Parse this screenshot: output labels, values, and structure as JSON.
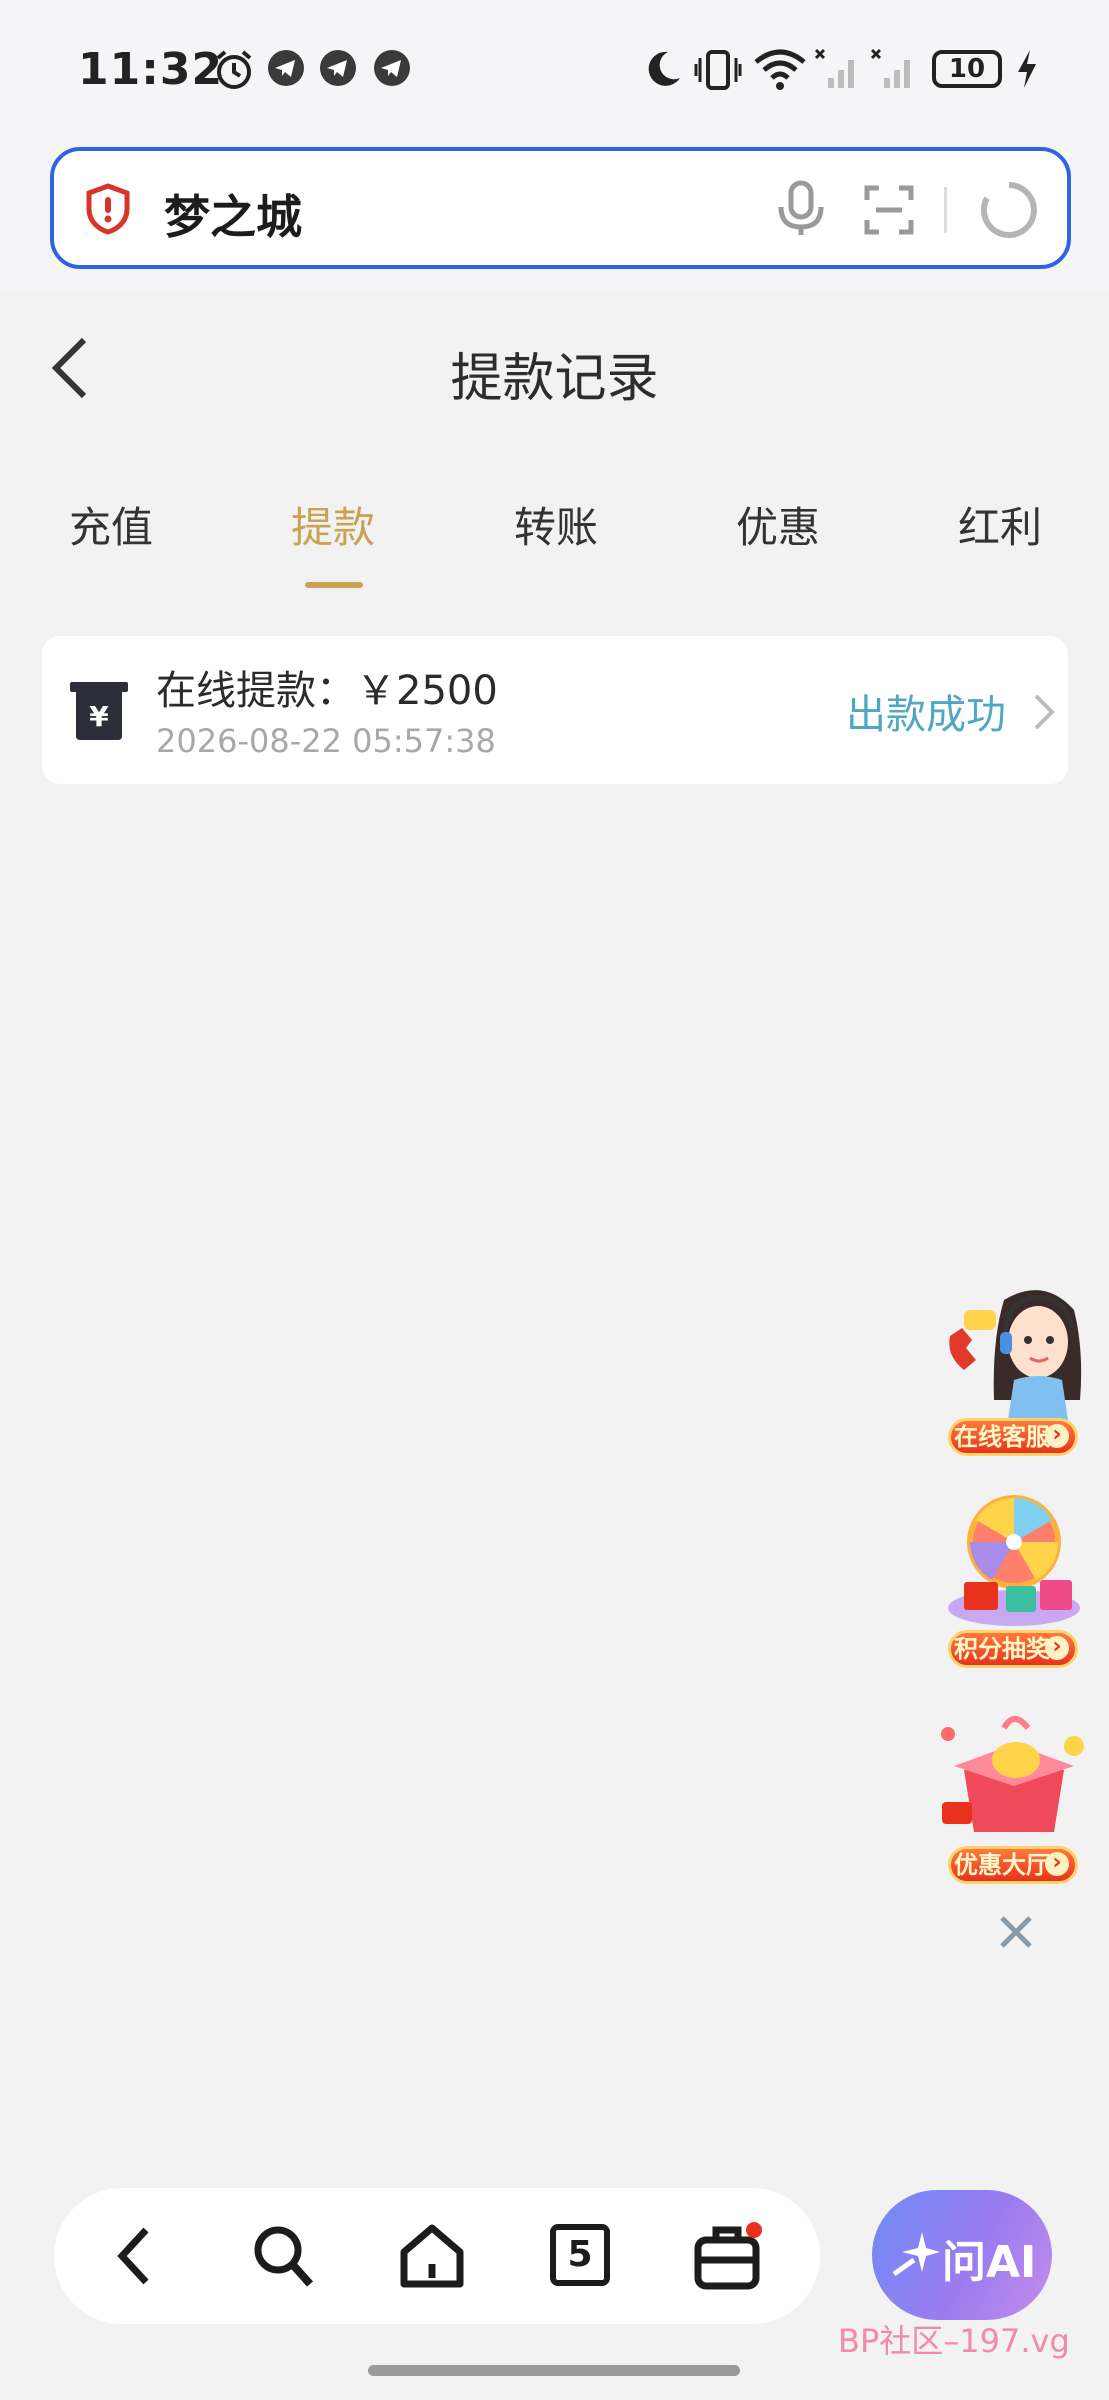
{
  "status_bar": {
    "time": "11:32",
    "battery": "10",
    "icons": [
      "alarm-icon",
      "telegram-icon",
      "telegram-icon",
      "telegram-icon",
      "moon-icon",
      "vibrate-icon",
      "wifi-icon",
      "signal-icon",
      "signal-icon",
      "charging-icon"
    ]
  },
  "address_bar": {
    "text": "梦之城",
    "icons": [
      "shield-alert-icon",
      "microphone-icon",
      "scan-icon",
      "refresh-icon"
    ]
  },
  "header": {
    "title": "提款记录"
  },
  "tabs": [
    {
      "label": "充值",
      "active": false
    },
    {
      "label": "提款",
      "active": true
    },
    {
      "label": "转账",
      "active": false
    },
    {
      "label": "优惠",
      "active": false
    },
    {
      "label": "红利",
      "active": false
    }
  ],
  "records": [
    {
      "title": "在线提款：￥2500",
      "time": "2026-08-22 05:57:38",
      "status": "出款成功"
    }
  ],
  "floating": {
    "customer_service": "在线客服",
    "lottery": "积分抽奖",
    "promotions": "优惠大厅"
  },
  "bottom_nav": {
    "tab_count": "5",
    "ai_label": "问AI"
  },
  "watermark": "BP社区–197.vg",
  "colors": {
    "accent_gold": "#c9a354",
    "status_blue": "#4fa7c4",
    "address_border": "#2f66e0"
  }
}
